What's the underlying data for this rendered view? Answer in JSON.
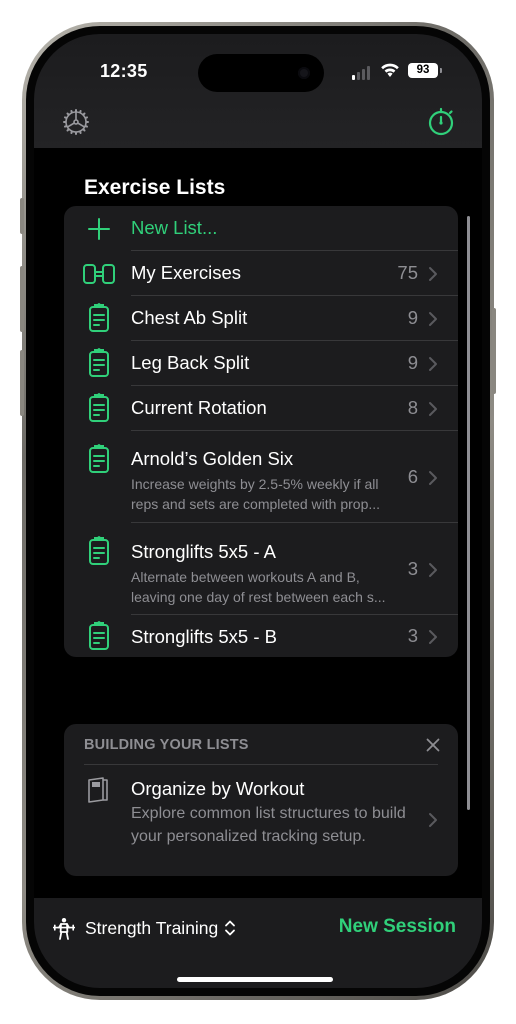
{
  "status_bar": {
    "time": "12:35",
    "battery": "93",
    "signal_bars_active": 1,
    "signal_bars_total": 4
  },
  "nav": {
    "left_icon": "gear-icon",
    "right_icon": "stopwatch-icon"
  },
  "colors": {
    "accent": "#30d07a",
    "background": "#000000",
    "card": "#1c1c1e",
    "secondary_text": "#8e8e93",
    "divider": "#38383a"
  },
  "section_title": "Exercise Lists",
  "lists": {
    "new_list_label": "New List...",
    "items": [
      {
        "icon": "dumbbell-icon",
        "title": "My Exercises",
        "subtitle": "",
        "count": "75"
      },
      {
        "icon": "clipboard-icon",
        "title": "Chest Ab Split",
        "subtitle": "",
        "count": "9"
      },
      {
        "icon": "clipboard-icon",
        "title": "Leg Back Split",
        "subtitle": "",
        "count": "9"
      },
      {
        "icon": "clipboard-icon",
        "title": "Current Rotation",
        "subtitle": "",
        "count": "8"
      },
      {
        "icon": "clipboard-icon",
        "title": "Arnold’s Golden Six",
        "subtitle": "Increase weights by 2.5-5% weekly if all reps and sets are completed with prop...",
        "count": "6"
      },
      {
        "icon": "clipboard-icon",
        "title": "Stronglifts 5x5 - A",
        "subtitle": "Alternate between workouts A and B, leaving one day of rest between each s...",
        "count": "3"
      },
      {
        "icon": "clipboard-icon",
        "title": "Stronglifts 5x5 - B",
        "subtitle": "",
        "count": "3"
      }
    ]
  },
  "tip": {
    "header": "BUILDING YOUR LISTS",
    "title": "Organize by Workout",
    "body": "Explore common list structures to build your personalized tracking setup."
  },
  "bottom_bar": {
    "activity_label": "Strength Training",
    "new_session_label": "New Session"
  }
}
